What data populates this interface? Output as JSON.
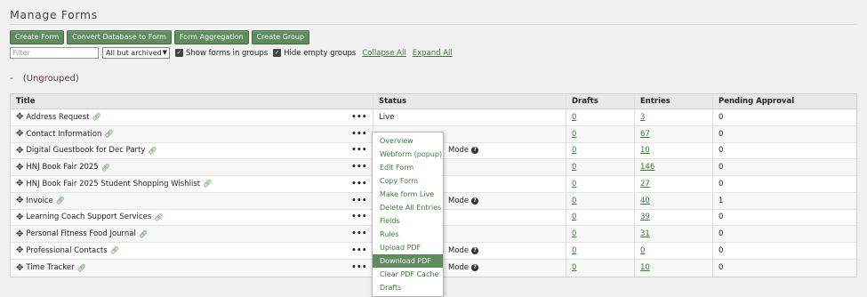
{
  "page": {
    "title": "Manage Forms"
  },
  "toolbar": {
    "buttons": [
      "Create Form",
      "Convert Database to Form",
      "Form Aggregation",
      "Create Group"
    ]
  },
  "filters": {
    "filter_placeholder": "Filter",
    "archive_select": "All but archived",
    "show_in_groups": "Show forms in groups",
    "hide_empty_groups": "Hide empty groups",
    "collapse_all": "Collapse All",
    "expand_all": "Expand All"
  },
  "group": {
    "dash": "-",
    "name": "(Ungrouped)"
  },
  "table": {
    "headers": {
      "title": "Title",
      "status": "Status",
      "drafts": "Drafts",
      "entries": "Entries",
      "pending": "Pending Approval"
    },
    "rows": [
      {
        "title": "Address Request",
        "status": "Live",
        "mode": "",
        "drafts": "0",
        "entries": "3",
        "pending": "0"
      },
      {
        "title": "Contact Information",
        "status": "",
        "mode": "",
        "drafts": "0",
        "entries": "67",
        "pending": "0"
      },
      {
        "title": "Digital Guestbook for Dec Party",
        "status": "",
        "mode": "Mode",
        "drafts": "0",
        "entries": "10",
        "pending": "0"
      },
      {
        "title": "HNJ Book Fair 2025",
        "status": "",
        "mode": "",
        "drafts": "0",
        "entries": "146",
        "pending": "0"
      },
      {
        "title": "HNJ Book Fair 2025 Student Shopping Wishlist",
        "status": "",
        "mode": "",
        "drafts": "0",
        "entries": "27",
        "pending": "0"
      },
      {
        "title": "Invoice",
        "status": "",
        "mode": "Mode",
        "drafts": "0",
        "entries": "40",
        "pending": "1"
      },
      {
        "title": "Learning Coach Support Services",
        "status": "",
        "mode": "",
        "drafts": "0",
        "entries": "39",
        "pending": "0"
      },
      {
        "title": "Personal Fitness Food Journal",
        "status": "",
        "mode": "",
        "drafts": "0",
        "entries": "31",
        "pending": "0"
      },
      {
        "title": "Professional Contacts",
        "status": "",
        "mode": "Mode",
        "drafts": "0",
        "entries": "0",
        "pending": "0"
      },
      {
        "title": "Time Tracker",
        "status": "",
        "mode": "Mode",
        "drafts": "0",
        "entries": "10",
        "pending": "0"
      }
    ]
  },
  "context_menu": {
    "items": [
      "Overview",
      "Webform (popup)",
      "Edit Form",
      "Copy Form",
      "Make form Live",
      "Delete All Entries",
      "Fields",
      "Rules",
      "Upload PDF",
      "Download PDF",
      "Clear PDF Cache",
      "Drafts"
    ],
    "active": "Download PDF"
  },
  "icons": {
    "move": "move-icon",
    "link": "link-icon",
    "help": "help-icon",
    "more": "more-icon"
  },
  "colors": {
    "accent": "#5d8c5d",
    "link": "#3c7a3c"
  }
}
